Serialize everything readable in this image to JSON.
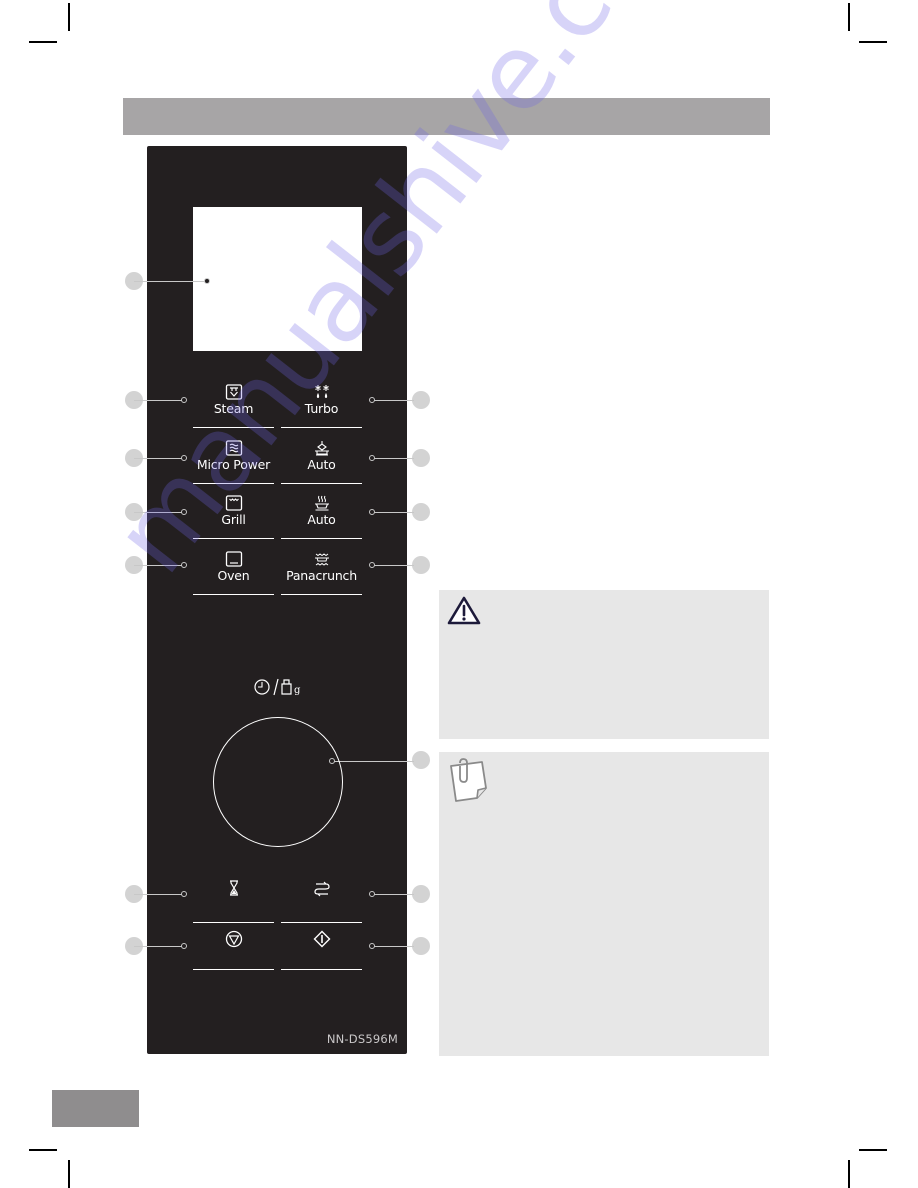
{
  "document": {
    "header_bar_text": "",
    "page_number": ""
  },
  "control_panel": {
    "display_label": "display-window",
    "buttons": [
      {
        "id": "steam",
        "label": "Steam",
        "icon": "steam-icon",
        "column": "left"
      },
      {
        "id": "turbo",
        "label": "Turbo",
        "icon": "turbo-defrost-icon",
        "column": "right"
      },
      {
        "id": "micro-power",
        "label": "Micro Power",
        "icon": "microwave-waves-icon",
        "column": "left"
      },
      {
        "id": "auto-steam",
        "label": "Auto",
        "icon": "auto-steam-icon",
        "column": "right"
      },
      {
        "id": "grill",
        "label": "Grill",
        "icon": "grill-icon",
        "column": "left"
      },
      {
        "id": "auto-cook",
        "label": "Auto",
        "icon": "auto-cook-icon",
        "column": "right"
      },
      {
        "id": "oven",
        "label": "Oven",
        "icon": "oven-icon",
        "column": "left"
      },
      {
        "id": "panacrunch",
        "label": "Panacrunch",
        "icon": "panacrunch-icon",
        "column": "right"
      },
      {
        "id": "timer",
        "label": "",
        "icon": "hourglass-icon",
        "column": "left"
      },
      {
        "id": "switch",
        "label": "",
        "icon": "switch-arrows-icon",
        "column": "right"
      },
      {
        "id": "stop",
        "label": "",
        "icon": "stop-icon",
        "column": "left"
      },
      {
        "id": "start",
        "label": "",
        "icon": "start-icon",
        "column": "right"
      }
    ],
    "dial": {
      "symbol": "time-weight-dial",
      "weight_unit": "g"
    },
    "model": "NN-DS596M"
  },
  "warning_box": {
    "icon": "warning-icon",
    "text": ""
  },
  "note_box": {
    "icon": "note-paperclip-icon",
    "text": ""
  },
  "watermark": "manualshive.com",
  "colors": {
    "panel": "#231f20",
    "header_bar": "#a7a5a6",
    "page_tab": "#8f8d8e",
    "callout": "#d3d3d3",
    "info_box": "#e7e7e7"
  }
}
